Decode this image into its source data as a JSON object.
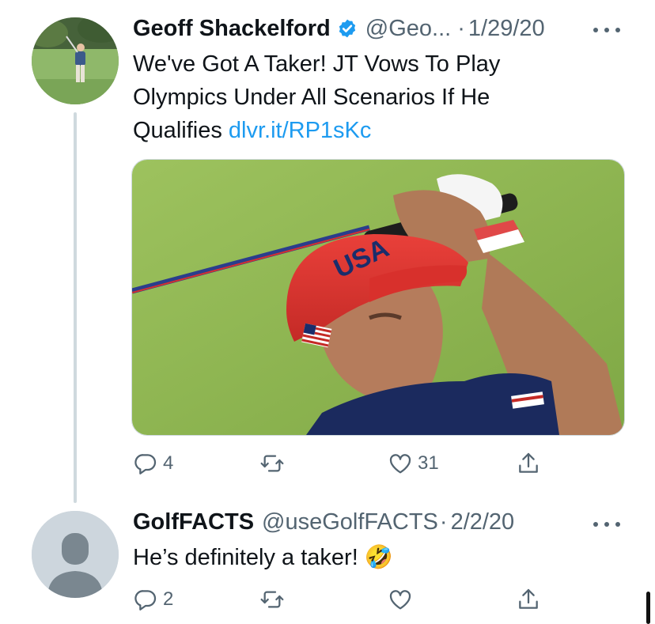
{
  "tweet1": {
    "author_name": "Geoff Shackelford",
    "handle": "@Geo...",
    "separator": "·",
    "date": "1/29/20",
    "text": "We've Got A Taker! JT Vows To Play Olympics Under All Scenarios If He Qualifies ",
    "link": "dlvr.it/RP1sKc",
    "media_logo": "USA",
    "actions": {
      "replies": "4",
      "retweets": "",
      "likes": "31"
    }
  },
  "tweet2": {
    "author_name": "GolfFACTS",
    "handle": "@useGolfFACTS",
    "separator": "·",
    "date": "2/2/20",
    "text": "He’s definitely a taker! ",
    "emoji": "🤣",
    "actions": {
      "replies": "2",
      "retweets": "",
      "likes": ""
    }
  },
  "colors": {
    "accent": "#1d9bf0",
    "secondary_text": "#536471",
    "verified_badge": "#1d9bf0",
    "thread_line": "#cfd9de"
  },
  "icons": {
    "reply": "speech-bubble",
    "retweet": "two-arrows-cycle",
    "like": "heart-outline",
    "share": "upload-arrow",
    "more": "three-dots-horizontal",
    "verified": "badge-checkmark"
  }
}
